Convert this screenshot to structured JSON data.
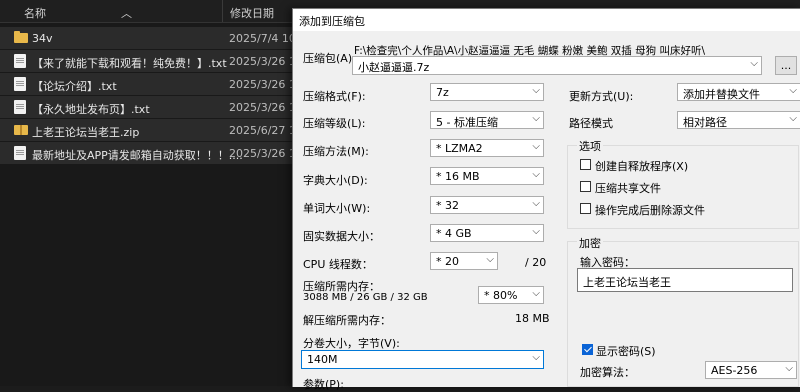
{
  "explorer": {
    "columns": {
      "name": "名称",
      "date": "修改日期"
    },
    "files": [
      {
        "icon": "folder-icon",
        "name": "34v",
        "date": "2025/7/4 10:..."
      },
      {
        "icon": "txt-file-icon",
        "name": "【来了就能下载和观看！纯免费！】.txt",
        "date": "2025/3/26 1..."
      },
      {
        "icon": "txt-file-icon",
        "name": "【论坛介绍】.txt",
        "date": "2025/3/26 1..."
      },
      {
        "icon": "txt-file-icon",
        "name": "【永久地址发布页】.txt",
        "date": "2025/3/26 1..."
      },
      {
        "icon": "zip-file-icon",
        "name": "上老王论坛当老王.zip",
        "date": "2025/6/27 1..."
      },
      {
        "icon": "txt-file-icon",
        "name": "最新地址及APP请发邮箱自动获取！！！....",
        "date": "2025/3/26 1..."
      }
    ]
  },
  "dialog": {
    "title": "添加到压缩包",
    "archive_label": "压缩包(A):",
    "archive_path": "F:\\检查完\\个人作品\\A\\小赵逼逼逼 无毛 蝴蝶 粉嫩 美鲍 双插 母狗 叫床好听\\",
    "archive_name": "小赵逼逼逼.7z",
    "browse_label": "...",
    "format_label": "压缩格式(F):",
    "format_value": "7z",
    "level_label": "压缩等级(L):",
    "level_value": "5 - 标准压缩",
    "method_label": "压缩方法(M):",
    "method_value": "* LZMA2",
    "dict_label": "字典大小(D):",
    "dict_value": "* 16 MB",
    "word_label": "单词大小(W):",
    "word_value": "* 32",
    "solid_label": "固实数据大小：",
    "solid_value": "* 4 GB",
    "cpu_label": "CPU 线程数：",
    "cpu_value": "* 20",
    "cpu_total": "/ 20",
    "mem_comp_label": "压缩所需内存：",
    "mem_comp_detail": "3088 MB / 26 GB / 32 GB",
    "mem_percent": "* 80%",
    "mem_decomp_label": "解压缩所需内存：",
    "mem_decomp_value": "18 MB",
    "split_label": "分卷大小，字节(V):",
    "split_value": "140M",
    "params_label": "参数(P):",
    "update_label": "更新方式(U):",
    "update_value": "添加并替换文件",
    "path_mode_label": "路径模式",
    "path_mode_value": "相对路径",
    "options_title": "选项",
    "opt_sfx": "创建自释放程序(X)",
    "opt_shared": "压缩共享文件",
    "opt_delete": "操作完成后删除源文件",
    "enc_title": "加密",
    "pwd_label": "输入密码：",
    "pwd_value": "上老王论坛当老王",
    "show_pwd": "显示密码(S)",
    "enc_method_label": "加密算法：",
    "enc_method_value": "AES-256"
  }
}
